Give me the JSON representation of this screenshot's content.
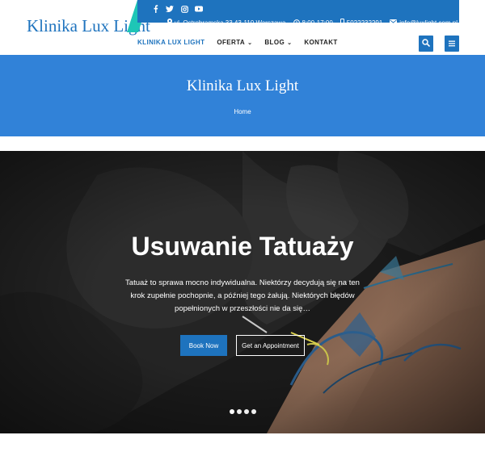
{
  "site": {
    "logo": "Klinika Lux Light"
  },
  "topbar": {
    "social": [
      "facebook-icon",
      "twitter-icon",
      "instagram-icon",
      "youtube-icon"
    ],
    "address": "ul. Ostrobramska 33 43-110 Warszawa",
    "hours": "8:00-17:00",
    "phone": "5022232291",
    "email": "info@luxlight.com.pl"
  },
  "nav": {
    "items": [
      {
        "label": "KLINIKA LUX LIGHT",
        "active": true
      },
      {
        "label": "OFERTA",
        "dropdown": true
      },
      {
        "label": "BLOG",
        "dropdown": true
      },
      {
        "label": "KONTAKT"
      }
    ]
  },
  "banner": {
    "title": "Klinika Lux Light",
    "breadcrumb": "Home"
  },
  "hero": {
    "title": "Usuwanie Tatuaży",
    "text": "Tatuaż to sprawa mocno indywidualna. Niektórzy decydują się na ten krok zupełnie pochopnie, a później tego żałują. Niektórych błędów popełnionych w przeszłości nie da się…",
    "book_label": "Book Now",
    "appointment_label": "Get an Appointment",
    "slides": 4,
    "active_slide": 0
  },
  "colors": {
    "brand": "#1e73be",
    "banner": "#3182d8",
    "accent": "#1ec6b6"
  }
}
